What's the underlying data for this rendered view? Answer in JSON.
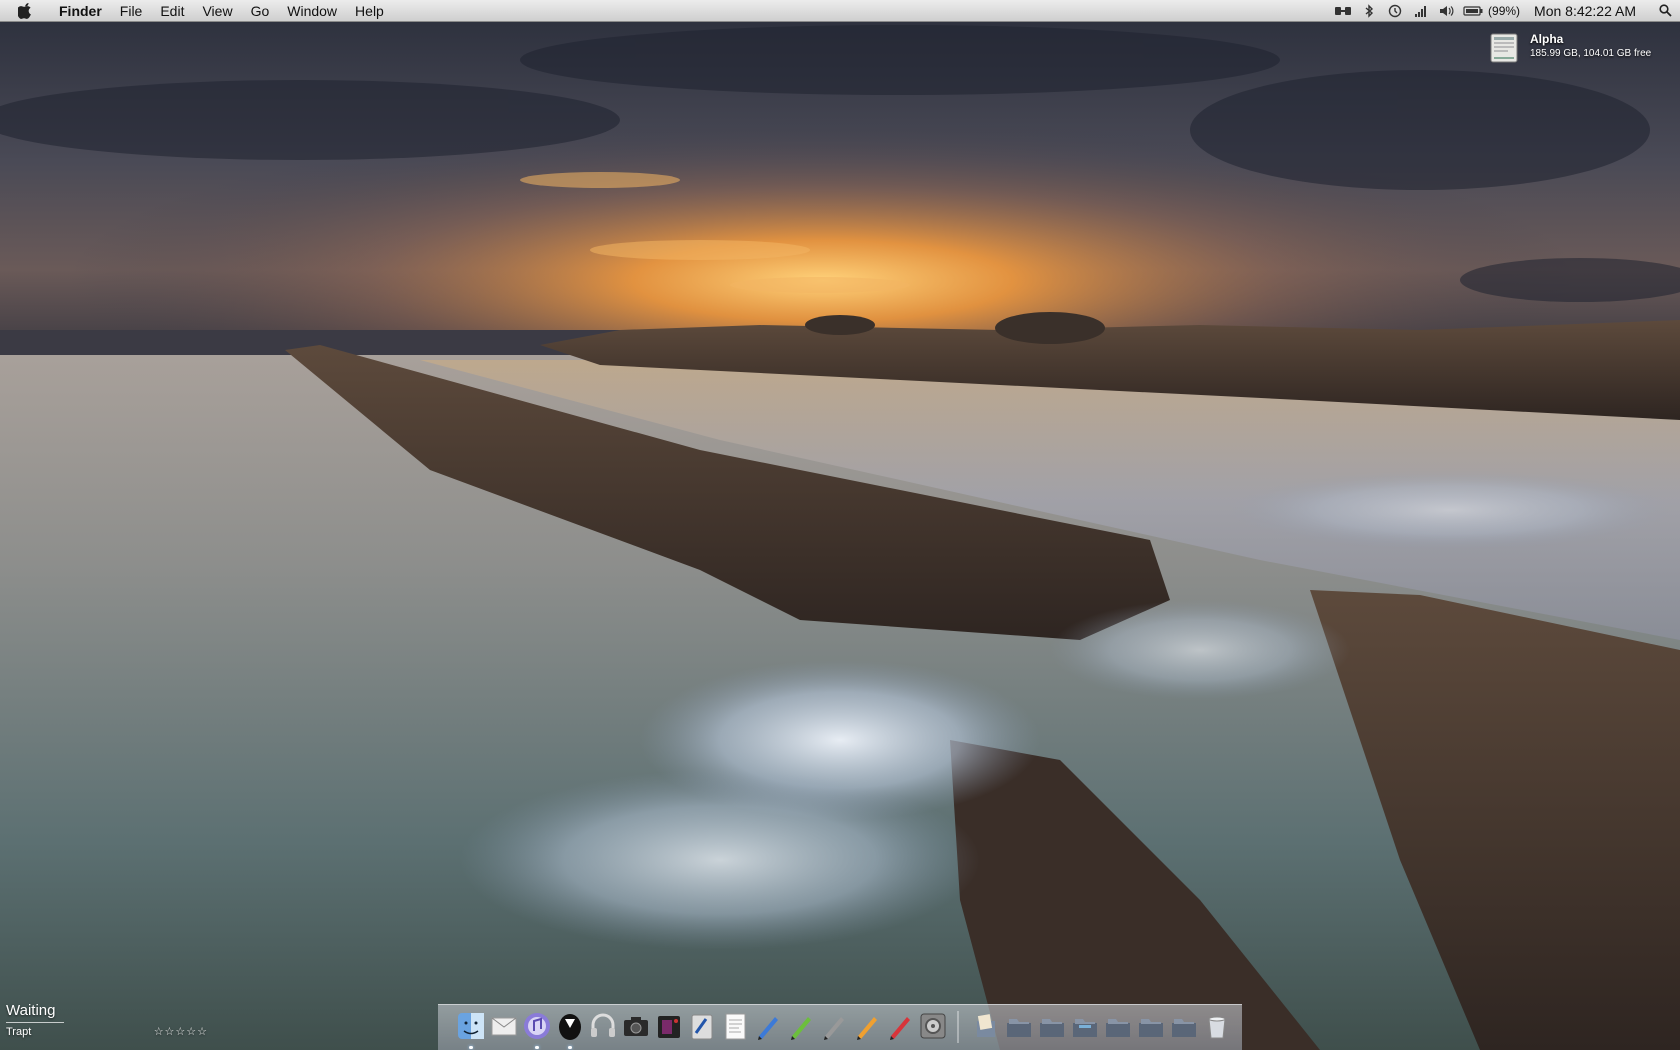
{
  "menubar": {
    "app_name": "Finder",
    "menus": [
      "File",
      "Edit",
      "View",
      "Go",
      "Window",
      "Help"
    ],
    "status_icons": [
      "mirror-displays-icon",
      "bluetooth-icon",
      "time-machine-icon",
      "wifi-icon",
      "volume-icon",
      "battery-icon"
    ],
    "battery_percent": "(99%)",
    "clock": "Mon 8:42:22 AM"
  },
  "desktop": {
    "drive": {
      "name": "Alpha",
      "capacity": "185.99 GB, 104.01 GB free",
      "icon": "hard-disk-icon"
    }
  },
  "itunes_widget": {
    "status": "Waiting",
    "app": "Trapt",
    "rating": "☆☆☆☆☆",
    "rating_value": 0
  },
  "dock": {
    "apps": [
      {
        "name": "finder-icon"
      },
      {
        "name": "mail-icon"
      },
      {
        "name": "itunes-icon"
      },
      {
        "name": "adium-icon"
      },
      {
        "name": "headphones-icon"
      },
      {
        "name": "camera-icon"
      },
      {
        "name": "photo-booth-icon"
      },
      {
        "name": "script-editor-icon"
      },
      {
        "name": "textedit-icon"
      },
      {
        "name": "pencil-blue-icon"
      },
      {
        "name": "pencil-green-icon"
      },
      {
        "name": "pencil-gray-icon"
      },
      {
        "name": "pencil-orange-icon"
      },
      {
        "name": "pencil-red-icon"
      },
      {
        "name": "system-preferences-icon"
      }
    ],
    "stacks": [
      {
        "name": "documents-stack-icon"
      },
      {
        "name": "folder-stack-icon"
      },
      {
        "name": "folder-stack-icon"
      },
      {
        "name": "folder-stack-icon"
      },
      {
        "name": "folder-stack-icon"
      },
      {
        "name": "folder-stack-icon"
      },
      {
        "name": "folder-stack-icon"
      },
      {
        "name": "trash-icon"
      }
    ]
  },
  "colors": {
    "menubar": "#e4e4e4",
    "sky_dark": "#2b2f3d",
    "sunset_orange": "#f2a24a",
    "water": "#6d7f88",
    "rock": "#4a3c33"
  }
}
